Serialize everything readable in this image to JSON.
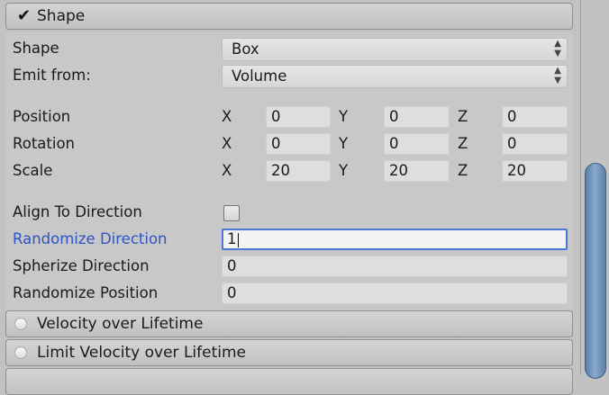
{
  "shape_module": {
    "title": "Shape",
    "shape": {
      "label": "Shape",
      "value": "Box"
    },
    "emit_from": {
      "label": "Emit from:",
      "value": "Volume"
    },
    "position": {
      "label": "Position",
      "x": "0",
      "y": "0",
      "z": "0"
    },
    "rotation": {
      "label": "Rotation",
      "x": "0",
      "y": "0",
      "z": "0"
    },
    "scale": {
      "label": "Scale",
      "x": "20",
      "y": "20",
      "z": "20"
    },
    "axes": {
      "x": "X",
      "y": "Y",
      "z": "Z"
    },
    "align_to_direction": {
      "label": "Align To Direction",
      "checked": false
    },
    "randomize_direction": {
      "label": "Randomize Direction",
      "value": "1"
    },
    "spherize_direction": {
      "label": "Spherize Direction",
      "value": "0"
    },
    "randomize_position": {
      "label": "Randomize Position",
      "value": "0"
    }
  },
  "velocity_module": {
    "title": "Velocity over Lifetime"
  },
  "limit_velocity_module": {
    "title": "Limit Velocity over Lifetime"
  },
  "colors": {
    "focus_border": "#4a78d8",
    "highlight_label": "#2d55c8",
    "scrollbar": "#6f92bb"
  }
}
